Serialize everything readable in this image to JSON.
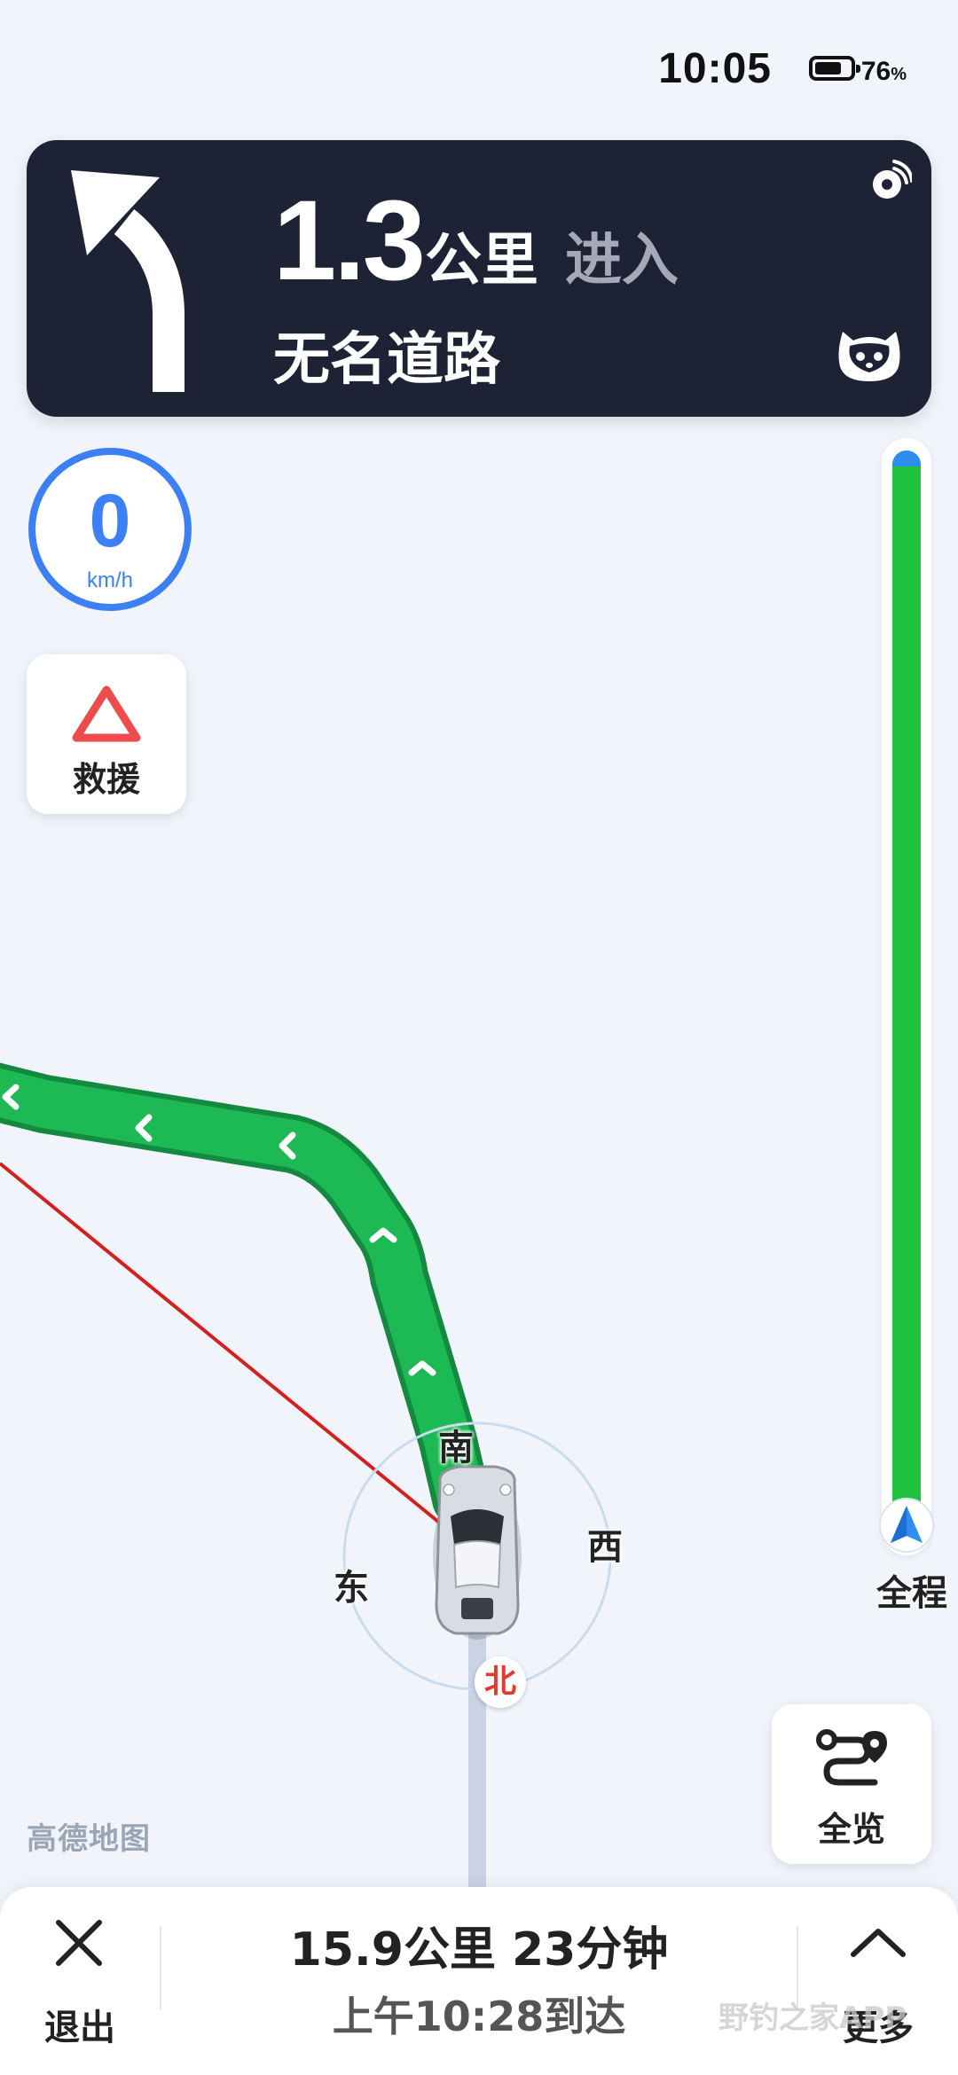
{
  "status_bar": {
    "time": "10:05",
    "battery_percent": "76",
    "battery_unit": "%",
    "battery_level": 0.76
  },
  "nav_card": {
    "turn_direction_icon": "turn-left-arrow-icon",
    "distance_value": "1.3",
    "distance_unit": "公里",
    "action": "进入",
    "road_name": "无名道路",
    "broadcast_icon": "broadcast-icon",
    "assistant_icon": "assistant-cat-icon"
  },
  "speed": {
    "value": "0",
    "unit": "km/h"
  },
  "rescue": {
    "label": "救援",
    "icon": "warning-triangle-icon"
  },
  "route_progress": {
    "remaining_fraction": 1.0,
    "overview_label": "全程",
    "marker_icon": "navigation-arrow-icon"
  },
  "compass": {
    "north": "北",
    "south": "南",
    "east": "东",
    "west": "西"
  },
  "full_view": {
    "label": "全览",
    "icon": "route-overview-icon"
  },
  "map": {
    "logo_text": "高德地图",
    "colors": {
      "route": "#1db954",
      "direct_line": "#d61f1f",
      "accent": "#3d80f5"
    }
  },
  "bottom_panel": {
    "exit_label": "退出",
    "exit_icon": "close-icon",
    "trip_distance": "15.9公里",
    "trip_time": "23分钟",
    "arrival": "上午10:28到达",
    "more_label": "更多",
    "more_icon": "chevron-up-icon"
  },
  "watermark": "野钓之家APP"
}
